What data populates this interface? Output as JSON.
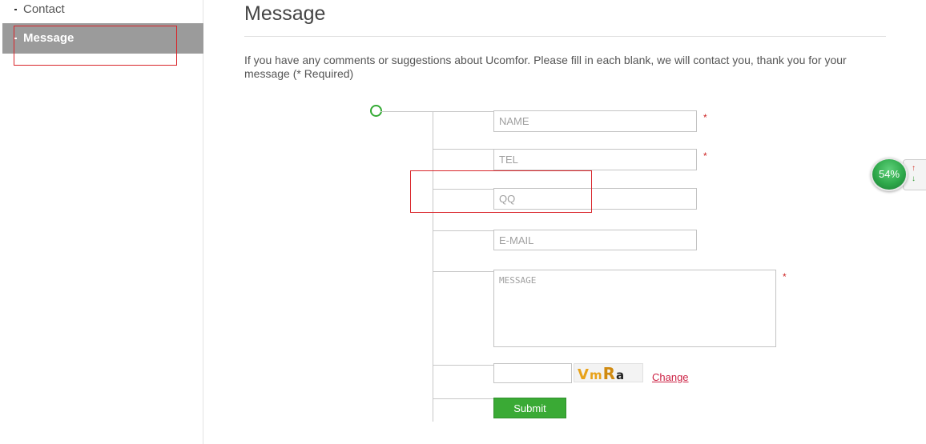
{
  "sidebar": {
    "items": [
      {
        "label": "Contact",
        "active": false
      },
      {
        "label": "Message",
        "active": true
      }
    ]
  },
  "main": {
    "title": "Message",
    "intro": "If you have any comments or suggestions about Ucomfor. Please fill in each blank, we will contact you, thank you for your message (* Required)"
  },
  "form": {
    "name_placeholder": "NAME",
    "tel_placeholder": "TEL",
    "qq_placeholder": "QQ",
    "email_placeholder": "E-MAIL",
    "message_placeholder": "MESSAGE",
    "required_mark": "*",
    "captcha_text": "VmRa",
    "captcha_chars": [
      "V",
      "m",
      "R",
      "a"
    ],
    "change_label": "Change",
    "submit_label": "Submit"
  },
  "widget": {
    "percent": "54%",
    "up_icon": "arrow-up-icon",
    "down_icon": "arrow-down-icon"
  },
  "colors": {
    "accent_green": "#3aaa35",
    "required_red": "#cc2222",
    "sidebar_active_bg": "#9b9b9b",
    "annotation_red": "#d9252a"
  }
}
